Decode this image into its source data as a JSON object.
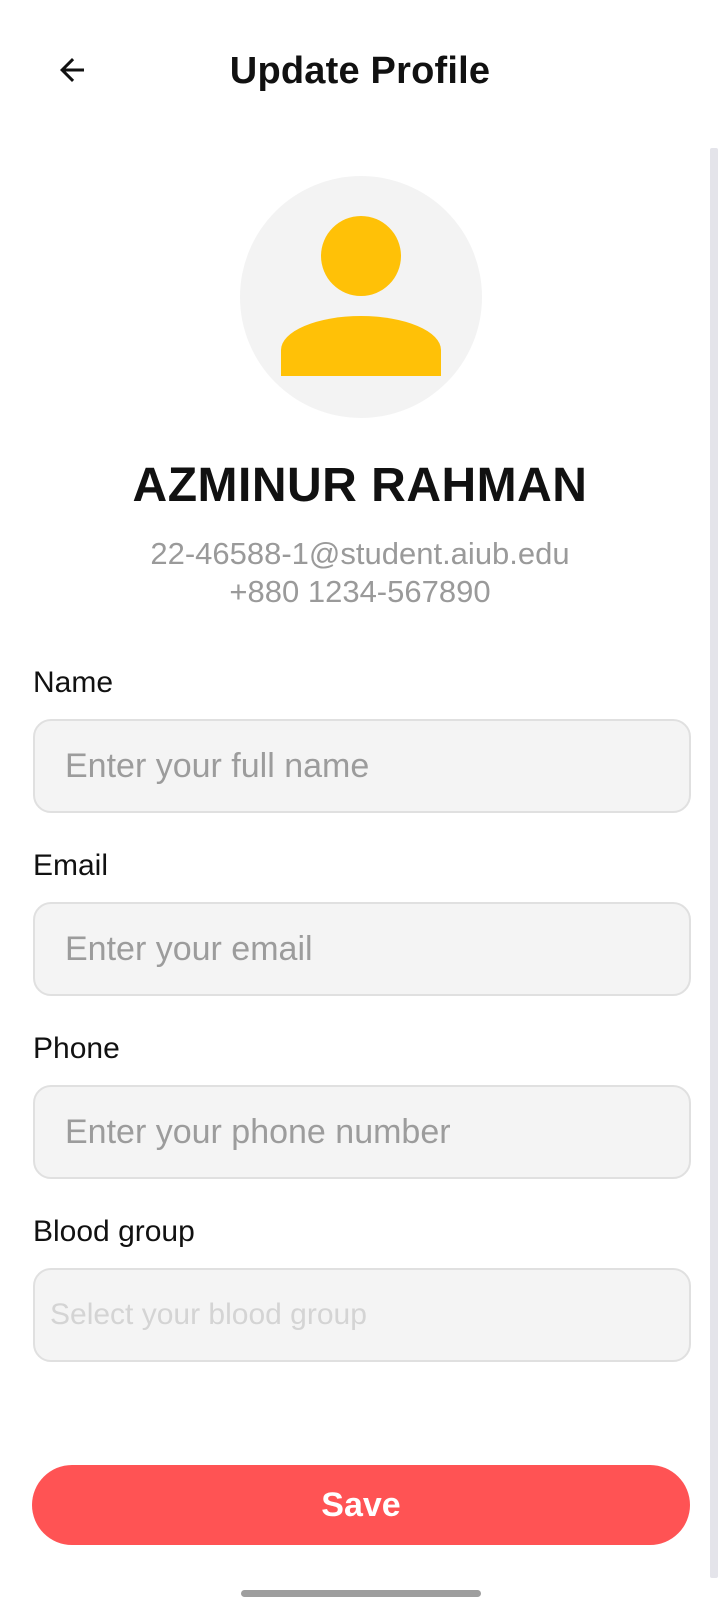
{
  "header": {
    "title": "Update Profile",
    "back_icon": "arrow-left-icon"
  },
  "profile": {
    "avatar_icon": "person-icon",
    "avatar_color": "#ffc107",
    "name": "AZMINUR RAHMAN",
    "email": "22-46588-1@student.aiub.edu",
    "phone": "+880 1234-567890"
  },
  "form": {
    "name": {
      "label": "Name",
      "placeholder": "Enter your full name",
      "value": ""
    },
    "email": {
      "label": "Email",
      "placeholder": "Enter your email",
      "value": ""
    },
    "phone": {
      "label": "Phone",
      "placeholder": "Enter your phone number",
      "value": ""
    },
    "blood_group": {
      "label": "Blood group",
      "placeholder": "Select your blood group"
    }
  },
  "save_button": {
    "label": "Save",
    "color": "#ff5354"
  }
}
